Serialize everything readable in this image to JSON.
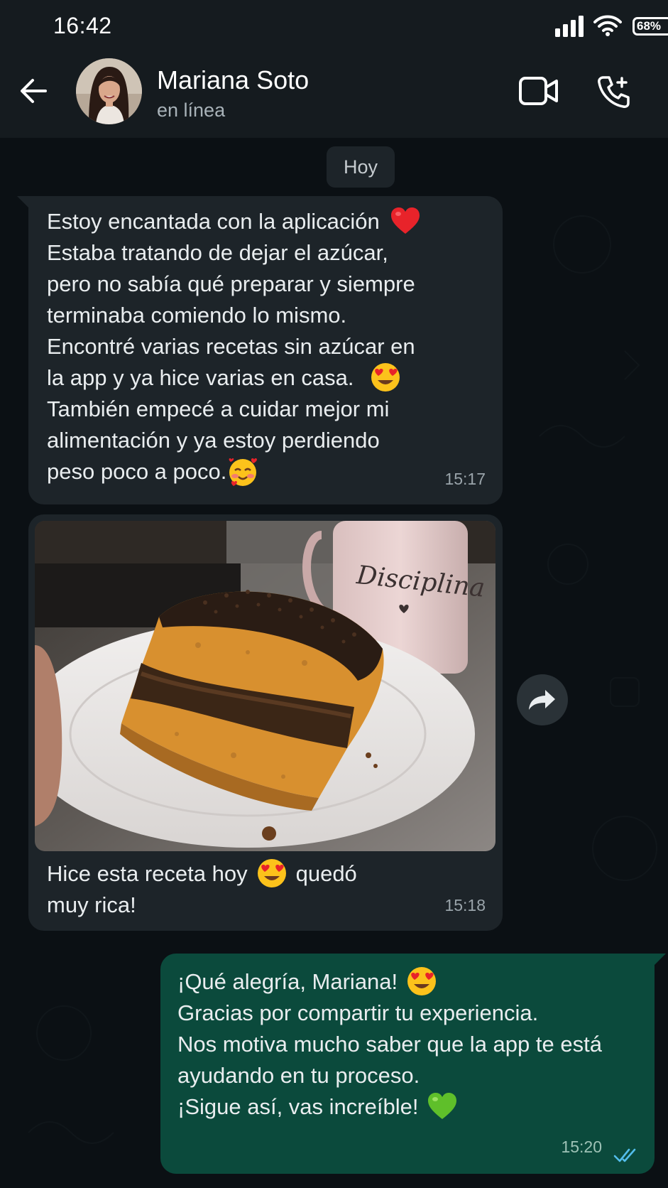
{
  "status_bar": {
    "time": "16:42",
    "battery": "68%"
  },
  "header": {
    "contact_name": "Mariana Soto",
    "contact_status": "en línea",
    "icons": [
      "back-arrow-icon",
      "video-camera-icon",
      "phone-add-icon"
    ]
  },
  "chat": {
    "date_chip": "Hoy",
    "messages": [
      {
        "direction": "incoming",
        "lines": [
          "Estoy encantada con la aplicación",
          "Estaba tratando de dejar el azúcar,",
          "pero no sabía qué preparar y siempre",
          "terminaba comiendo lo mismo.",
          "Encontré varias recetas sin azúcar en",
          "la app y ya hice varias en casa.",
          "También empecé a cuidar mejor mi",
          "alimentación y ya estoy perdiendo",
          "peso poco a poco."
        ],
        "time": "15:17"
      },
      {
        "direction": "incoming",
        "type": "image",
        "image_text": "Disciplina",
        "caption_lines": [
          "Hice esta receta hoy",
          "quedó",
          "muy rica!"
        ],
        "time": "15:18"
      },
      {
        "direction": "outgoing",
        "lines": [
          "¡Qué alegría, Mariana!",
          "Gracias por compartir tu experiencia.",
          "Nos motiva mucho saber que la app te está",
          "ayudando en tu proceso.",
          "¡Sigue así, vas increíble!"
        ],
        "time": "15:20",
        "status": "read"
      }
    ]
  },
  "colors": {
    "background": "#0b1014",
    "header": "#151b1f",
    "incoming_bubble": "#1d2429",
    "outgoing_bubble": "#0b4a3c",
    "read_ticks": "#53bdeb"
  }
}
